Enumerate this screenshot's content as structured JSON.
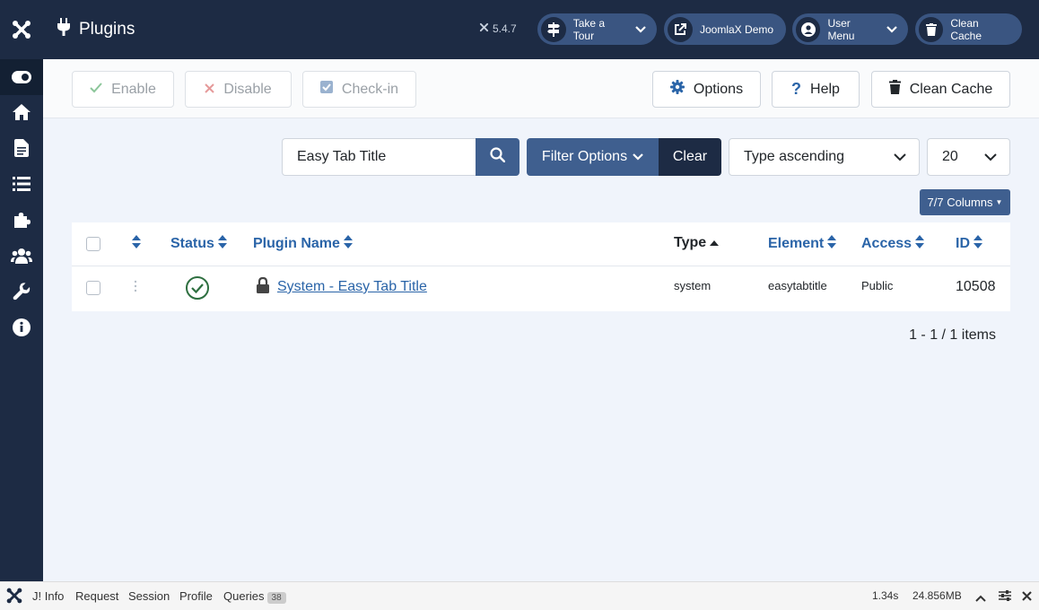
{
  "header": {
    "title": "Plugins",
    "version": "5.4.7",
    "buttons": {
      "tour": "Take a Tour",
      "demo": "JoomlaX Demo",
      "user": "User Menu",
      "cache": "Clean Cache"
    }
  },
  "toolbar": {
    "enable": "Enable",
    "disable": "Disable",
    "checkin": "Check-in",
    "options": "Options",
    "help": "Help",
    "clean_cache": "Clean Cache"
  },
  "filters": {
    "search_value": "Easy Tab Title",
    "filter_options": "Filter Options",
    "clear": "Clear",
    "sort": "Type ascending",
    "limit": "20",
    "columns": "7/7 Columns"
  },
  "table": {
    "headers": {
      "status": "Status",
      "name": "Plugin Name",
      "type": "Type",
      "element": "Element",
      "access": "Access",
      "id": "ID"
    },
    "rows": [
      {
        "name": "System - Easy Tab Title",
        "type": "system",
        "element": "easytabtitle",
        "access": "Public",
        "id": "10508"
      }
    ]
  },
  "pagination": "1 - 1 / 1 items",
  "debug": {
    "info": "J! Info",
    "request": "Request",
    "session": "Session",
    "profile": "Profile",
    "queries": "Queries",
    "queries_count": "38",
    "time": "1.34s",
    "memory": "24.856MB"
  },
  "colors": {
    "dark": "#1d2b44",
    "primary": "#3f5f8f",
    "link": "#2a64a8",
    "success": "#2e6f40",
    "page_bg": "#f0f4fb"
  }
}
